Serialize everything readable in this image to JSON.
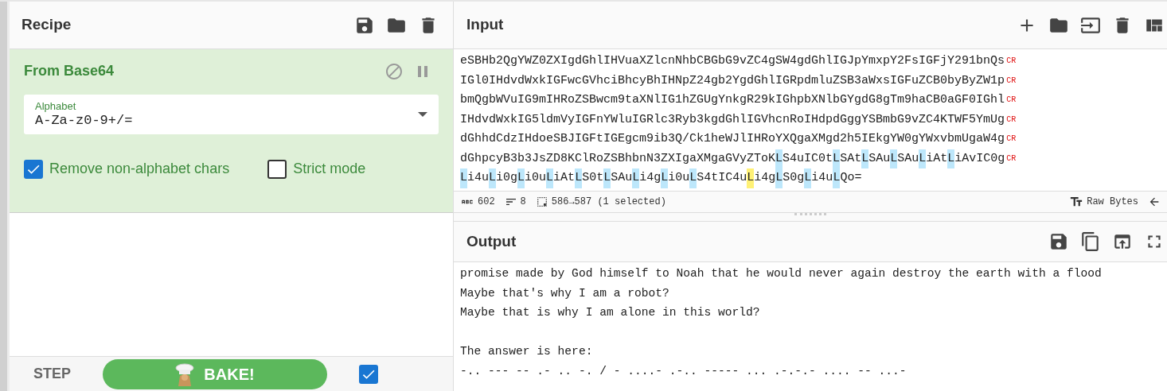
{
  "recipe": {
    "title": "Recipe",
    "operations": [
      {
        "title": "From Base64",
        "disabled": false,
        "paused": false,
        "field": {
          "label": "Alphabet",
          "value": "A-Za-z0-9+/="
        },
        "checkboxes": [
          {
            "label": "Remove non-alphabet chars",
            "checked": true
          },
          {
            "label": "Strict mode",
            "checked": false
          }
        ]
      }
    ],
    "step_label": "STEP",
    "bake_label": "BAKE!",
    "auto_bake": {
      "checked": true
    }
  },
  "input": {
    "title": "Input",
    "lines": [
      [
        {
          "text": "eSBHb2QgYWZ0ZXIgdGhlIHVuaXZlcnNhbCBGbG9vZC4gSW4gdGhlIGJpYmxpY2FsIGFjY291bnQs",
          "kind": "plain"
        },
        {
          "text": "CR",
          "kind": "eol"
        }
      ],
      [
        {
          "text": "IGl0IHdvdWxkIGFwcGVhciBhcyBhIHNpZ24gb2YgdGhlIGRpdmluZSB3aWxsIGFuZCB0byByZW1p",
          "kind": "plain"
        },
        {
          "text": "CR",
          "kind": "eol"
        }
      ],
      [
        {
          "text": "bmQgbWVuIG9mIHRoZSBwcm9taXNlIG1hZGUgYnkgR29kIGhpbXNlbGYgdG8gTm9haCB0aGF0IGhl",
          "kind": "plain"
        },
        {
          "text": "CR",
          "kind": "eol"
        }
      ],
      [
        {
          "text": "IHdvdWxkIG5ldmVyIGFnYWluIGRlc3Ryb3kgdGhlIGVhcnRoIHdpdGggYSBmbG9vZC4KTWF5YmUg",
          "kind": "plain"
        },
        {
          "text": "CR",
          "kind": "eol"
        }
      ],
      [
        {
          "text": "dGhhdCdzIHdoeSBJIGFtIGEgcm9ib3Q/Ck1heWJlIHRoYXQgaXMgd2h5IEkgYW0gYWxvbmUgaW4g",
          "kind": "plain"
        },
        {
          "text": "CR",
          "kind": "eol"
        }
      ],
      [
        {
          "text": "dGhpcyB3b3JsZD8KClRoZSBhbnN3ZXIgaXMgaGVyZToK",
          "kind": "plain"
        },
        {
          "text": "L",
          "kind": "match"
        },
        {
          "text": "S4uIC0t",
          "kind": "plain"
        },
        {
          "text": "L",
          "kind": "match"
        },
        {
          "text": "SAt",
          "kind": "plain"
        },
        {
          "text": "L",
          "kind": "match"
        },
        {
          "text": "SAu",
          "kind": "plain"
        },
        {
          "text": "L",
          "kind": "match"
        },
        {
          "text": "SAu",
          "kind": "plain"
        },
        {
          "text": "L",
          "kind": "match"
        },
        {
          "text": "iAt",
          "kind": "plain"
        },
        {
          "text": "L",
          "kind": "match"
        },
        {
          "text": "iAvIC0g",
          "kind": "plain"
        },
        {
          "text": "CR",
          "kind": "eol"
        }
      ],
      [
        {
          "text": "L",
          "kind": "match"
        },
        {
          "text": "i4u",
          "kind": "plain"
        },
        {
          "text": "L",
          "kind": "match"
        },
        {
          "text": "i0g",
          "kind": "plain"
        },
        {
          "text": "L",
          "kind": "match"
        },
        {
          "text": "i0u",
          "kind": "plain"
        },
        {
          "text": "L",
          "kind": "match"
        },
        {
          "text": "iAt",
          "kind": "plain"
        },
        {
          "text": "L",
          "kind": "match"
        },
        {
          "text": "S0t",
          "kind": "plain"
        },
        {
          "text": "L",
          "kind": "match"
        },
        {
          "text": "SAu",
          "kind": "plain"
        },
        {
          "text": "L",
          "kind": "match"
        },
        {
          "text": "i4g",
          "kind": "plain"
        },
        {
          "text": "L",
          "kind": "match"
        },
        {
          "text": "i0u",
          "kind": "plain"
        },
        {
          "text": "L",
          "kind": "match"
        },
        {
          "text": "S4tIC4u",
          "kind": "plain"
        },
        {
          "text": "L",
          "kind": "current"
        },
        {
          "text": "i4g",
          "kind": "plain"
        },
        {
          "text": "L",
          "kind": "match"
        },
        {
          "text": "S0g",
          "kind": "plain"
        },
        {
          "text": "L",
          "kind": "match"
        },
        {
          "text": "i4u",
          "kind": "plain"
        },
        {
          "text": "L",
          "kind": "match"
        },
        {
          "text": "Qo=",
          "kind": "plain"
        }
      ]
    ],
    "status": {
      "chars": "602",
      "lines": "8",
      "selection": "586→587 (1 selected)",
      "encoding": "Raw Bytes"
    }
  },
  "output": {
    "title": "Output",
    "paragraphs": [
      [
        "promise made by God himself to Noah that he would never again destroy the earth with a flood",
        "Maybe that's why I am a robot?",
        "Maybe that is why I am alone in this world?"
      ],
      [
        "The answer is here:",
        "-.. --- -- .- .. -. / - ....- .-.. ----- ... .-.-.- .... -- ...-"
      ]
    ]
  }
}
